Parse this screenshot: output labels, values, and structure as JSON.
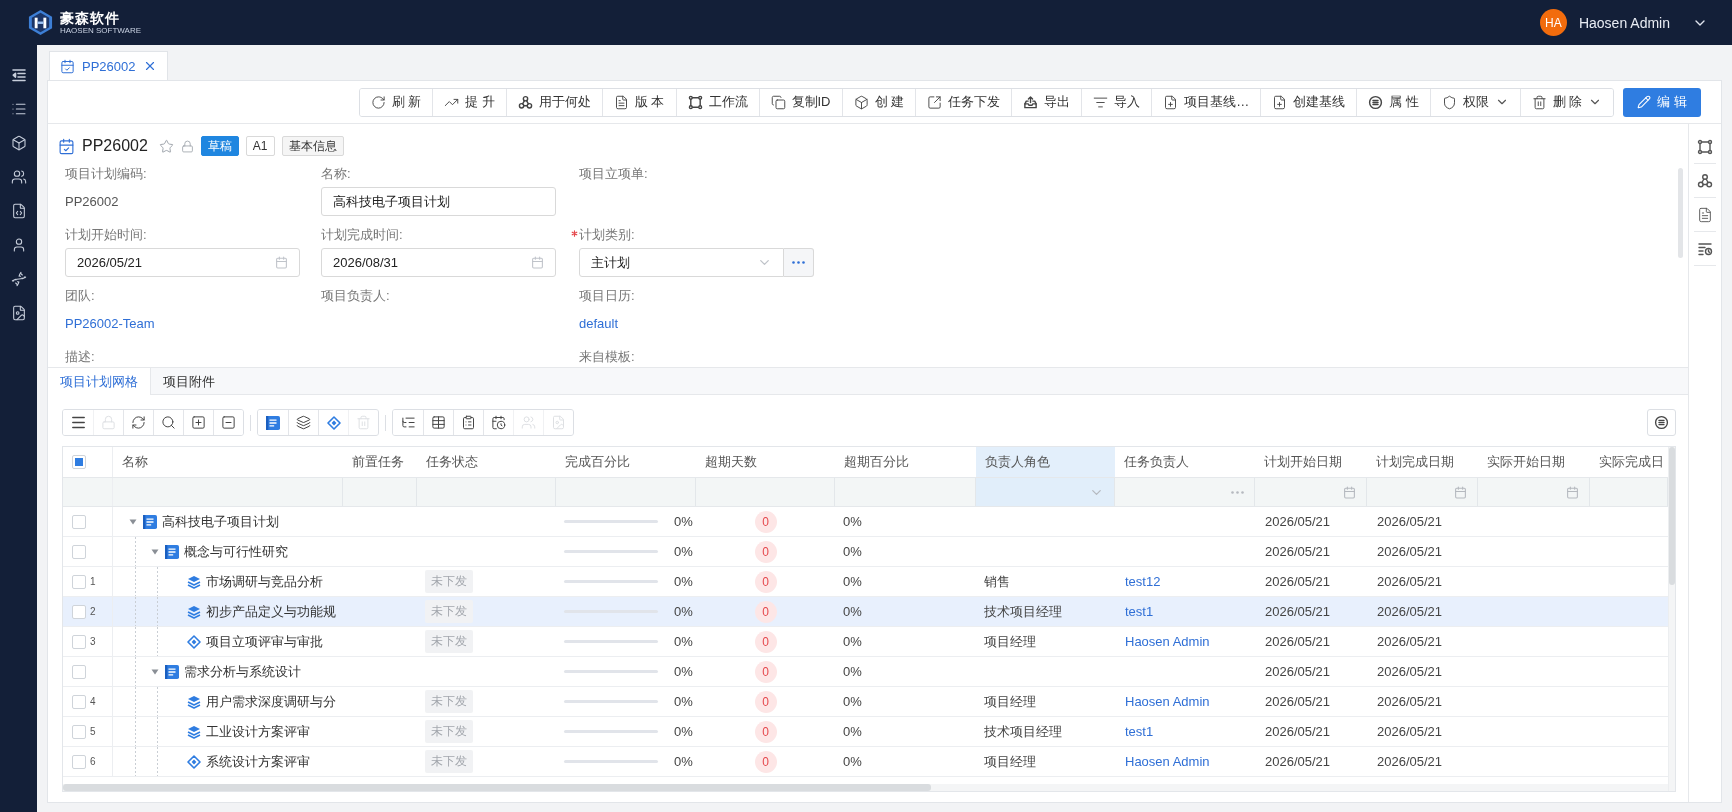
{
  "header": {
    "logo": {
      "name": "豪森软件",
      "subtitle": "HAOSEN SOFTWARE"
    },
    "user": {
      "initials": "HA",
      "name": "Haosen Admin"
    }
  },
  "doc_tabs": [
    {
      "label": "PP26002",
      "selected": true
    }
  ],
  "toolbar": [
    {
      "label": "刷 新",
      "dropdown": false,
      "primary": false
    },
    {
      "label": "提 升",
      "dropdown": false,
      "primary": false
    },
    {
      "label": "用于何处",
      "dropdown": false,
      "primary": false
    },
    {
      "label": "版 本",
      "dropdown": false,
      "primary": false
    },
    {
      "label": "工作流",
      "dropdown": false,
      "primary": false
    },
    {
      "label": "复制ID",
      "dropdown": false,
      "primary": false
    },
    {
      "label": "创 建",
      "dropdown": false,
      "primary": false
    },
    {
      "label": "任务下发",
      "dropdown": false,
      "primary": false
    },
    {
      "label": "导出",
      "dropdown": false,
      "primary": false
    },
    {
      "label": "导入",
      "dropdown": false,
      "primary": false
    },
    {
      "label": "项目基线…",
      "dropdown": false,
      "primary": false
    },
    {
      "label": "创建基线",
      "dropdown": false,
      "primary": false
    },
    {
      "label": "属 性",
      "dropdown": false,
      "primary": false
    },
    {
      "label": "权限",
      "dropdown": true,
      "primary": false
    },
    {
      "label": "删 除",
      "dropdown": true,
      "primary": false
    },
    {
      "label": "编 辑",
      "dropdown": false,
      "primary": true
    }
  ],
  "record": {
    "title": "PP26002",
    "tags": [
      {
        "label": "草稿",
        "kind": "status"
      },
      {
        "label": "A1",
        "kind": "version"
      },
      {
        "label": "基本信息",
        "kind": "info"
      }
    ]
  },
  "form": {
    "rows": [
      [
        {
          "label": "项目计划编码:",
          "kind": "text",
          "value": "PP26002",
          "required": false
        },
        {
          "label": "名称:",
          "kind": "input",
          "value": "高科技电子项目计划",
          "required": false
        },
        {
          "label": "项目立项单:",
          "kind": "empty",
          "required": false
        }
      ],
      [
        {
          "label": "计划开始时间:",
          "kind": "date",
          "value": "2026/05/21",
          "required": false
        },
        {
          "label": "计划完成时间:",
          "kind": "date",
          "value": "2026/08/31",
          "required": false
        },
        {
          "label": "计划类别:",
          "kind": "select",
          "value": "主计划",
          "required": true
        }
      ],
      [
        {
          "label": "团队:",
          "kind": "link",
          "value": "PP26002-Team",
          "required": false
        },
        {
          "label": "项目负责人:",
          "kind": "empty",
          "required": false
        },
        {
          "label": "项目日历:",
          "kind": "link",
          "value": "default",
          "required": false
        }
      ],
      [
        {
          "label": "描述:",
          "kind": "empty",
          "required": false
        },
        null,
        {
          "label": "来自模板:",
          "kind": "empty",
          "required": false
        }
      ]
    ]
  },
  "section_tabs": [
    {
      "label": "项目计划网格",
      "selected": true
    },
    {
      "label": "项目附件",
      "selected": false
    }
  ],
  "grid_toolbar": {
    "groups": [
      [
        {
          "disabled": false
        },
        {
          "disabled": true
        },
        {
          "disabled": false
        },
        {
          "disabled": false
        },
        {
          "disabled": false
        },
        {
          "disabled": false
        }
      ],
      [
        {
          "disabled": false
        },
        {
          "disabled": false
        },
        {
          "disabled": false
        },
        {
          "disabled": true
        }
      ],
      [
        {
          "disabled": false
        },
        {
          "disabled": false
        },
        {
          "disabled": false
        },
        {
          "disabled": false
        },
        {
          "disabled": true
        },
        {
          "disabled": true
        }
      ]
    ]
  },
  "grid": {
    "select_all": {
      "checked": false,
      "indeterminate": true
    },
    "columns": [
      {
        "label": "名称",
        "filter": {
          "kind": "text"
        },
        "highlighted": false
      },
      {
        "label": "前置任务",
        "filter": {
          "kind": "text"
        },
        "highlighted": false
      },
      {
        "label": "任务状态",
        "filter": {
          "kind": "text"
        },
        "highlighted": false
      },
      {
        "label": "完成百分比",
        "filter": {
          "kind": "text"
        },
        "highlighted": false
      },
      {
        "label": "超期天数",
        "filter": {
          "kind": "text"
        },
        "highlighted": false
      },
      {
        "label": "超期百分比",
        "filter": {
          "kind": "text"
        },
        "highlighted": false
      },
      {
        "label": "负责人角色",
        "filter": {
          "kind": "select"
        },
        "highlighted": true
      },
      {
        "label": "任务负责人",
        "filter": {
          "kind": "picker"
        },
        "highlighted": false
      },
      {
        "label": "计划开始日期",
        "filter": {
          "kind": "date"
        },
        "highlighted": false
      },
      {
        "label": "计划完成日期",
        "filter": {
          "kind": "date"
        },
        "highlighted": false
      },
      {
        "label": "实际开始日期",
        "filter": {
          "kind": "date"
        },
        "highlighted": false
      },
      {
        "label": "实际完成日",
        "filter": {
          "kind": "text"
        },
        "highlighted": false
      }
    ],
    "rows": [
      {
        "name": "高科技电子项目计划",
        "kind": "summary",
        "expanded": true,
        "selected": false,
        "checked": false,
        "level": 0,
        "progress": "0%",
        "overdue_days": "0",
        "overdue_pct": "0%",
        "plan_start": "2026/05/21",
        "plan_end": "2026/05/21",
        "children": [
          {
            "name": "概念与可行性研究",
            "kind": "summary",
            "expanded": true,
            "selected": false,
            "checked": false,
            "level": 0,
            "progress": "0%",
            "overdue_days": "0",
            "overdue_pct": "0%",
            "plan_start": "2026/05/21",
            "plan_end": "2026/05/21",
            "children": [
              {
                "number": "1",
                "name": "市场调研与竞品分析",
                "kind": "task",
                "selected": false,
                "checked": false,
                "status": "未下发",
                "level": 0,
                "progress": "0%",
                "overdue_days": "0",
                "overdue_pct": "0%",
                "role": "销售",
                "owner": "test12",
                "plan_start": "2026/05/21",
                "plan_end": "2026/05/21"
              },
              {
                "number": "2",
                "name": "初步产品定义与功能规",
                "kind": "task",
                "selected": true,
                "checked": false,
                "status": "未下发",
                "level": 0,
                "progress": "0%",
                "overdue_days": "0",
                "overdue_pct": "0%",
                "role": "技术项目经理",
                "owner": "test1",
                "plan_start": "2026/05/21",
                "plan_end": "2026/05/21"
              },
              {
                "number": "3",
                "name": "项目立项评审与审批",
                "kind": "milestone",
                "selected": false,
                "checked": false,
                "status": "未下发",
                "level": 0,
                "progress": "0%",
                "overdue_days": "0",
                "overdue_pct": "0%",
                "role": "项目经理",
                "owner": "Haosen Admin",
                "plan_start": "2026/05/21",
                "plan_end": "2026/05/21"
              }
            ]
          },
          {
            "name": "需求分析与系统设计",
            "kind": "summary",
            "expanded": true,
            "selected": false,
            "checked": false,
            "level": 0,
            "progress": "0%",
            "overdue_days": "0",
            "overdue_pct": "0%",
            "plan_start": "2026/05/21",
            "plan_end": "2026/05/21",
            "children": [
              {
                "number": "4",
                "name": "用户需求深度调研与分",
                "kind": "task",
                "selected": false,
                "checked": false,
                "status": "未下发",
                "level": 0,
                "progress": "0%",
                "overdue_days": "0",
                "overdue_pct": "0%",
                "role": "项目经理",
                "owner": "Haosen Admin",
                "plan_start": "2026/05/21",
                "plan_end": "2026/05/21"
              },
              {
                "number": "5",
                "name": "工业设计方案评审",
                "kind": "task",
                "selected": false,
                "checked": false,
                "status": "未下发",
                "level": 0,
                "progress": "0%",
                "overdue_days": "0",
                "overdue_pct": "0%",
                "role": "技术项目经理",
                "owner": "test1",
                "plan_start": "2026/05/21",
                "plan_end": "2026/05/21"
              },
              {
                "number": "6",
                "name": "系统设计方案评审",
                "kind": "milestone",
                "selected": false,
                "checked": false,
                "status": "未下发",
                "level": 0,
                "progress": "0%",
                "overdue_days": "0",
                "overdue_pct": "0%",
                "role": "项目经理",
                "owner": "Haosen Admin",
                "plan_start": "2026/05/21",
                "plan_end": "2026/05/21"
              }
            ]
          }
        ]
      }
    ]
  }
}
